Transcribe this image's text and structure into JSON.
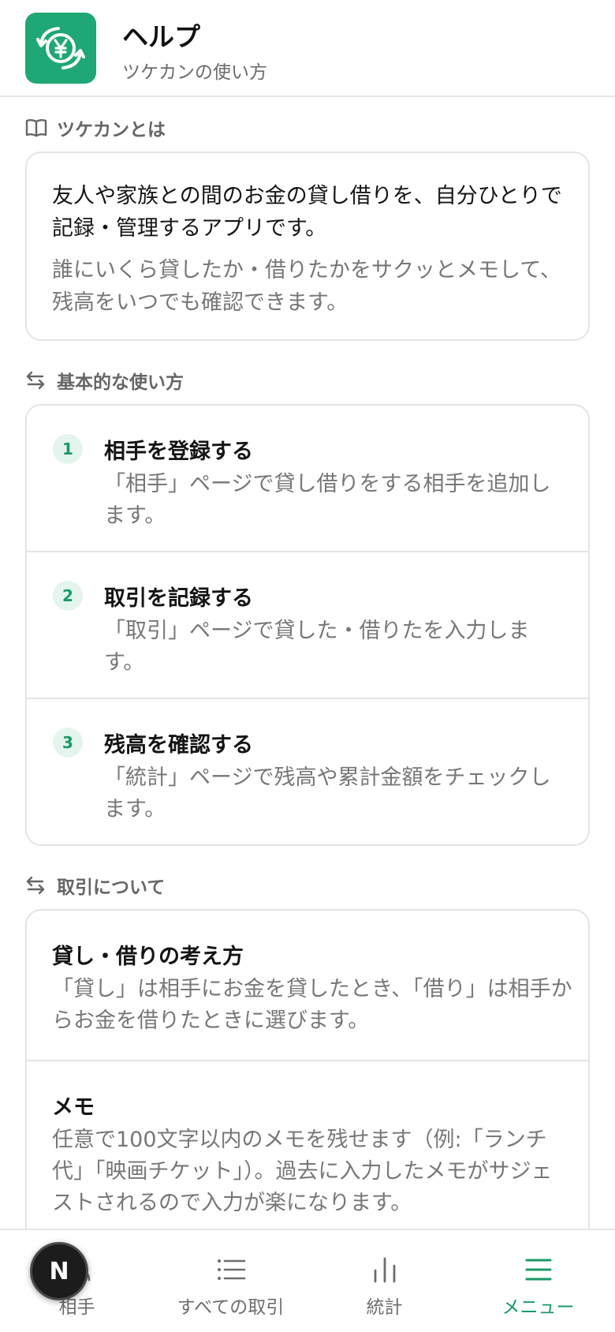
{
  "header": {
    "title": "ヘルプ",
    "subtitle": "ツケカンの使い方",
    "logo_icon": "yen-exchange-icon",
    "brand_color": "#1fa775"
  },
  "about": {
    "heading": "ツケカンとは",
    "heading_icon": "book-icon",
    "main": "友人や家族との間のお金の貸し借りを、自分ひとりで記録・管理するアプリです。",
    "sub": "誰にいくら貸したか・借りたかをサクッとメモして、残高をいつでも確認できます。"
  },
  "basics": {
    "heading": "基本的な使い方",
    "heading_icon": "arrows-swap-icon",
    "steps": [
      {
        "num": "1",
        "title": "相手を登録する",
        "desc": "「相手」ページで貸し借りをする相手を追加します。"
      },
      {
        "num": "2",
        "title": "取引を記録する",
        "desc": "「取引」ページで貸した・借りたを入力します。"
      },
      {
        "num": "3",
        "title": "残高を確認する",
        "desc": "「統計」ページで残高や累計金額をチェックします。"
      }
    ]
  },
  "transactions": {
    "heading": "取引について",
    "heading_icon": "arrows-swap-icon",
    "topics": [
      {
        "title": "貸し・借りの考え方",
        "desc": "「貸し」は相手にお金を貸したとき、「借り」は相手からお金を借りたときに選びます。"
      },
      {
        "title": "メモ",
        "desc": "任意で100文字以内のメモを残せます（例:「ランチ代」「映画チケット」）。過去に入力したメモがサジェストされるので入力が楽になります。"
      }
    ]
  },
  "nav": {
    "items": [
      {
        "label": "相手",
        "icon": "users-icon"
      },
      {
        "label": "すべての取引",
        "icon": "list-icon"
      },
      {
        "label": "統計",
        "icon": "bar-chart-icon"
      },
      {
        "label": "メニュー",
        "icon": "menu-icon",
        "active": true
      }
    ],
    "active_color": "#1a9a66"
  },
  "dev_badge": {
    "label": "N"
  }
}
